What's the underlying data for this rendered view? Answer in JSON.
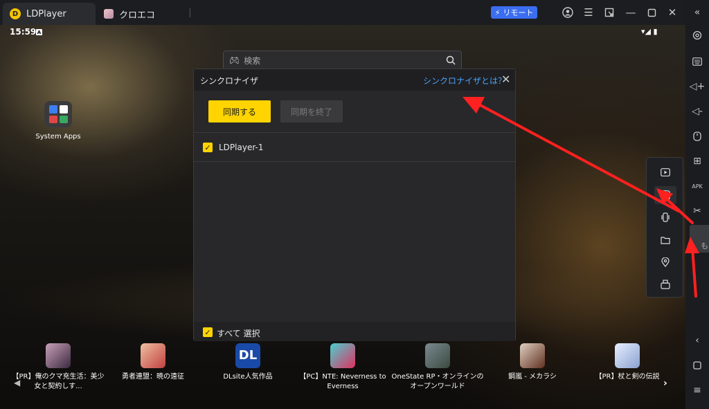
{
  "titlebar": {
    "app_tab": "LDPlayer",
    "app_tab_logo": "D",
    "second_tab": "クロエコ",
    "remote_label": "リモート",
    "icons": [
      "user-icon",
      "menu-icon",
      "window-resize-icon",
      "minimize-icon",
      "maximize-icon",
      "close-icon"
    ]
  },
  "android": {
    "time": "15:59",
    "status_badge": "A",
    "status_icons": "▾◢ ▮",
    "search_placeholder": "検索",
    "desktop_icon_label": "System Apps"
  },
  "sync_dialog": {
    "title": "シンクロナイザ",
    "help_link": "シンクロナイザとは？",
    "start_button": "同期する",
    "stop_button": "同期を終了",
    "instances": [
      {
        "name": "LDPlayer-1",
        "checked": true
      }
    ],
    "select_all": "すべて 選択",
    "select_all_checked": true
  },
  "dock": {
    "apps": [
      {
        "label": "【PR】俺のクマ充生活：美少女と契約しす...",
        "color1": "#c9a0b8",
        "color2": "#3a2a40"
      },
      {
        "label": "勇者連盟：暁の遠征",
        "color1": "#f0c0a0",
        "color2": "#c04040"
      },
      {
        "label": "DLsite人気作品",
        "color1": "#1a4aa8",
        "color2": "#1a4aa8",
        "text": "DL"
      },
      {
        "label": "【PC】NTE: Neverness to Everness",
        "color1": "#4ad0d0",
        "color2": "#e03060"
      },
      {
        "label": "OneState RP・オンラインのオープンワールド",
        "color1": "#7a8a90",
        "color2": "#3a4a40"
      },
      {
        "label": "鋼嵐 - メカラシ",
        "color1": "#e0d0c0",
        "color2": "#603020"
      },
      {
        "label": "【PR】杖と剣の伝説",
        "color1": "#e8f0ff",
        "color2": "#8aa0d0"
      }
    ]
  },
  "sidebar": {
    "icons": [
      "collapse-icon",
      "settings-icon",
      "keyboard-icon",
      "volume-up-icon",
      "volume-down-icon",
      "mouse-icon",
      "add-window-icon",
      "apk-icon",
      "scissors-icon",
      "more-icon",
      "back-icon",
      "home-icon",
      "recent-apps-icon"
    ],
    "more_tab_text": "も"
  },
  "flyout": {
    "icons": [
      "record-icon",
      "sync-icon",
      "shake-icon",
      "folder-icon",
      "location-icon",
      "rotate-icon"
    ]
  },
  "colors": {
    "accent_yellow": "#ffd400",
    "link_blue": "#4aa3ff",
    "remote_blue": "#3b6df0",
    "arrow_red": "#ff2020"
  }
}
